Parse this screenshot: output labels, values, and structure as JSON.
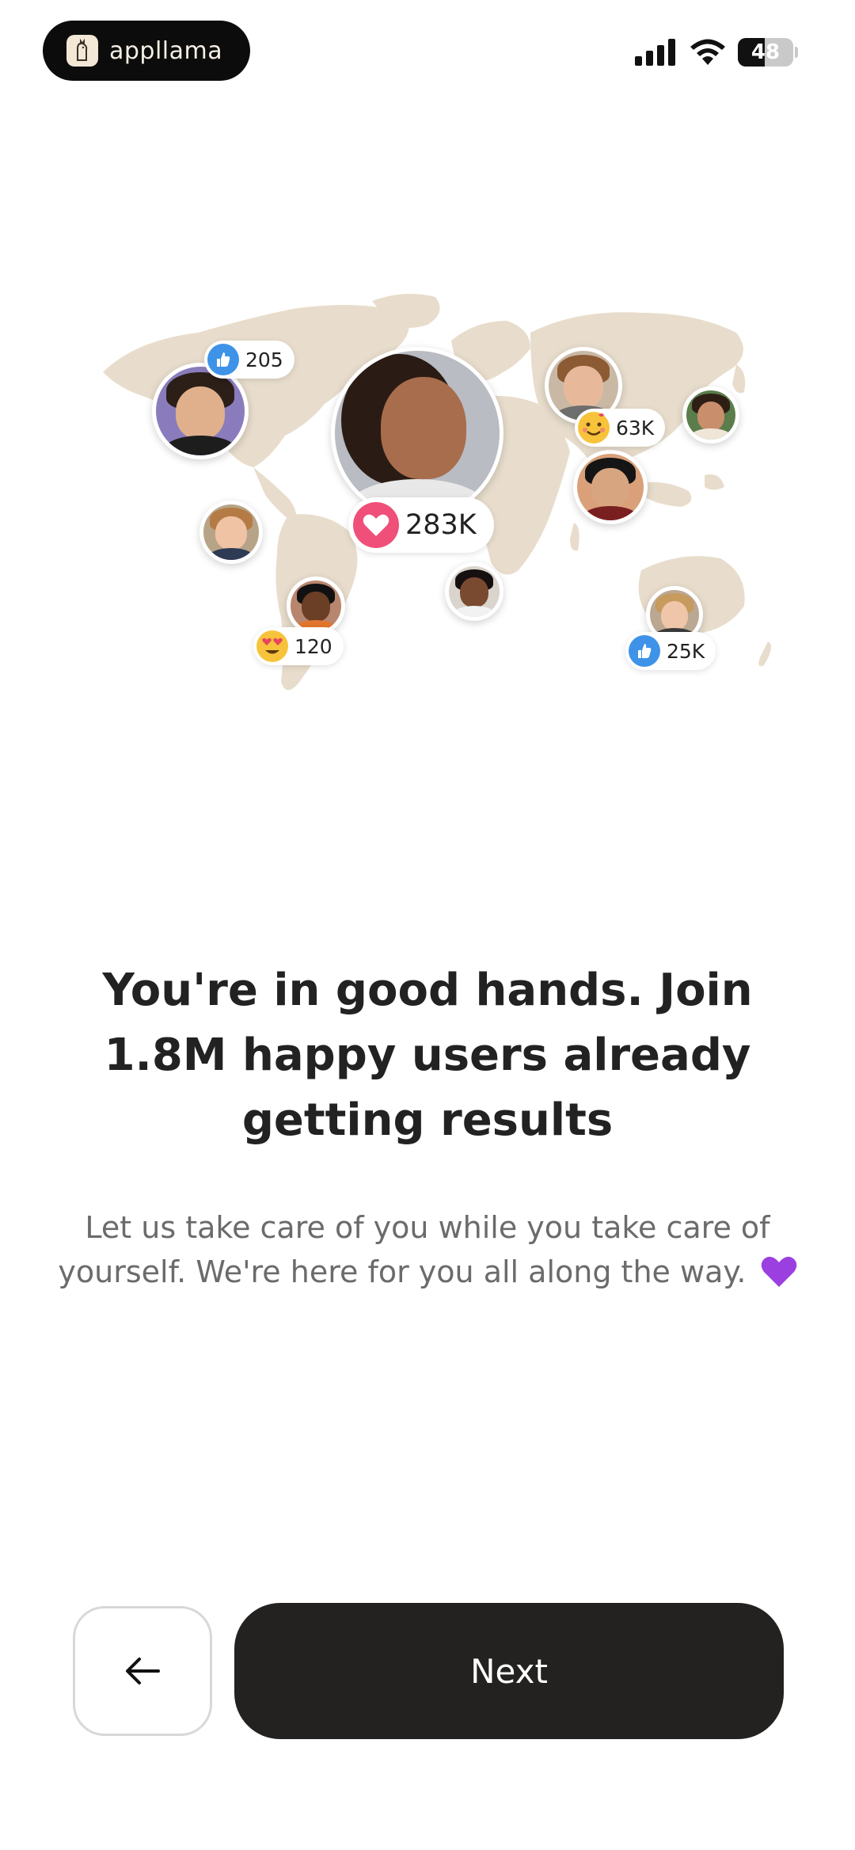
{
  "status_bar": {
    "brand_name": "appllama",
    "battery_level": "48",
    "battery_fraction": 0.48
  },
  "map": {
    "badges": [
      {
        "value": "205",
        "icon": "thumbs-up-icon"
      },
      {
        "value": "283K",
        "icon": "heart-icon"
      },
      {
        "value": "63K",
        "icon": "hug-emoji-icon"
      },
      {
        "value": "120",
        "icon": "heart-eyes-emoji-icon"
      },
      {
        "value": "25K",
        "icon": "thumbs-up-icon"
      }
    ]
  },
  "content": {
    "headline": "You're in good hands. Join 1.8M happy users already getting results",
    "subtext": "Let us take care of you while you take care of yourself. We're here for you all along the way."
  },
  "buttons": {
    "back_icon": "arrow-left-icon",
    "next_label": "Next"
  },
  "colors": {
    "map_land": "#e8ddcc",
    "heart_pink": "#ef4f78",
    "thumb_blue": "#3e93e8",
    "emoji_yellow": "#f7c33b",
    "primary_button": "#232221",
    "purple_heart": "#9b3fe0"
  }
}
